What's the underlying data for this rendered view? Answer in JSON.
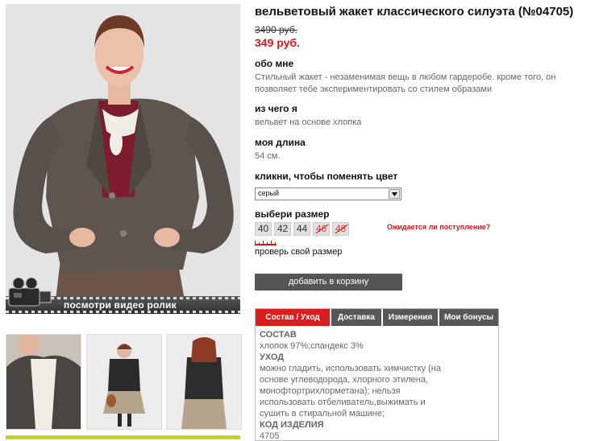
{
  "product": {
    "title": "вельветовый жакет классического силуэта (№04705)",
    "old_price": "3490 руб.",
    "new_price": "349 руб."
  },
  "about": {
    "heading": "обо мне",
    "text": "Стильный жакет - незаменимая вещь в любом гардеробе. кроме того, он позволяет тебе экспериментировать со стилем образами"
  },
  "material": {
    "heading": "из чего я",
    "text": "вельвет на основе хлопка"
  },
  "length": {
    "heading": "моя длина",
    "text": "54 см."
  },
  "color": {
    "heading": "кликни, чтобы поменять цвет",
    "selected": "серый"
  },
  "size": {
    "heading": "выбери размер",
    "options": [
      {
        "label": "40",
        "available": true
      },
      {
        "label": "42",
        "available": true
      },
      {
        "label": "44",
        "available": true
      },
      {
        "label": "46",
        "available": false
      },
      {
        "label": "48",
        "available": false
      }
    ],
    "expected_link": "Ожидается ли поступление?",
    "check_link": "проверь свой размер"
  },
  "cart_button": "добавить в корзину",
  "video": {
    "label": "посмотри видео ролик"
  },
  "tabs": {
    "items": [
      "Состав / Уход",
      "Доставка",
      "Измерения",
      "Мои бонусы"
    ],
    "active": 0,
    "content": {
      "composition_heading": "СОСТАВ",
      "composition_text": "хлопок 97%;спандекс 3%",
      "care_heading": "УХОД",
      "care_text": "можно гладить, использовать химчистку (на основе углеводорода, хлорного этилена, монофтортрихлорметана); нельзя использовать отбеливатель,выжимать и сушить в стиральной машине;",
      "code_heading": "КОД ИЗДЕЛИЯ",
      "code_text": "4705"
    }
  },
  "colors": {
    "accent_red": "#e3121b",
    "tab_active": "#d81e1e",
    "tab": "#575757",
    "button": "#555555"
  }
}
